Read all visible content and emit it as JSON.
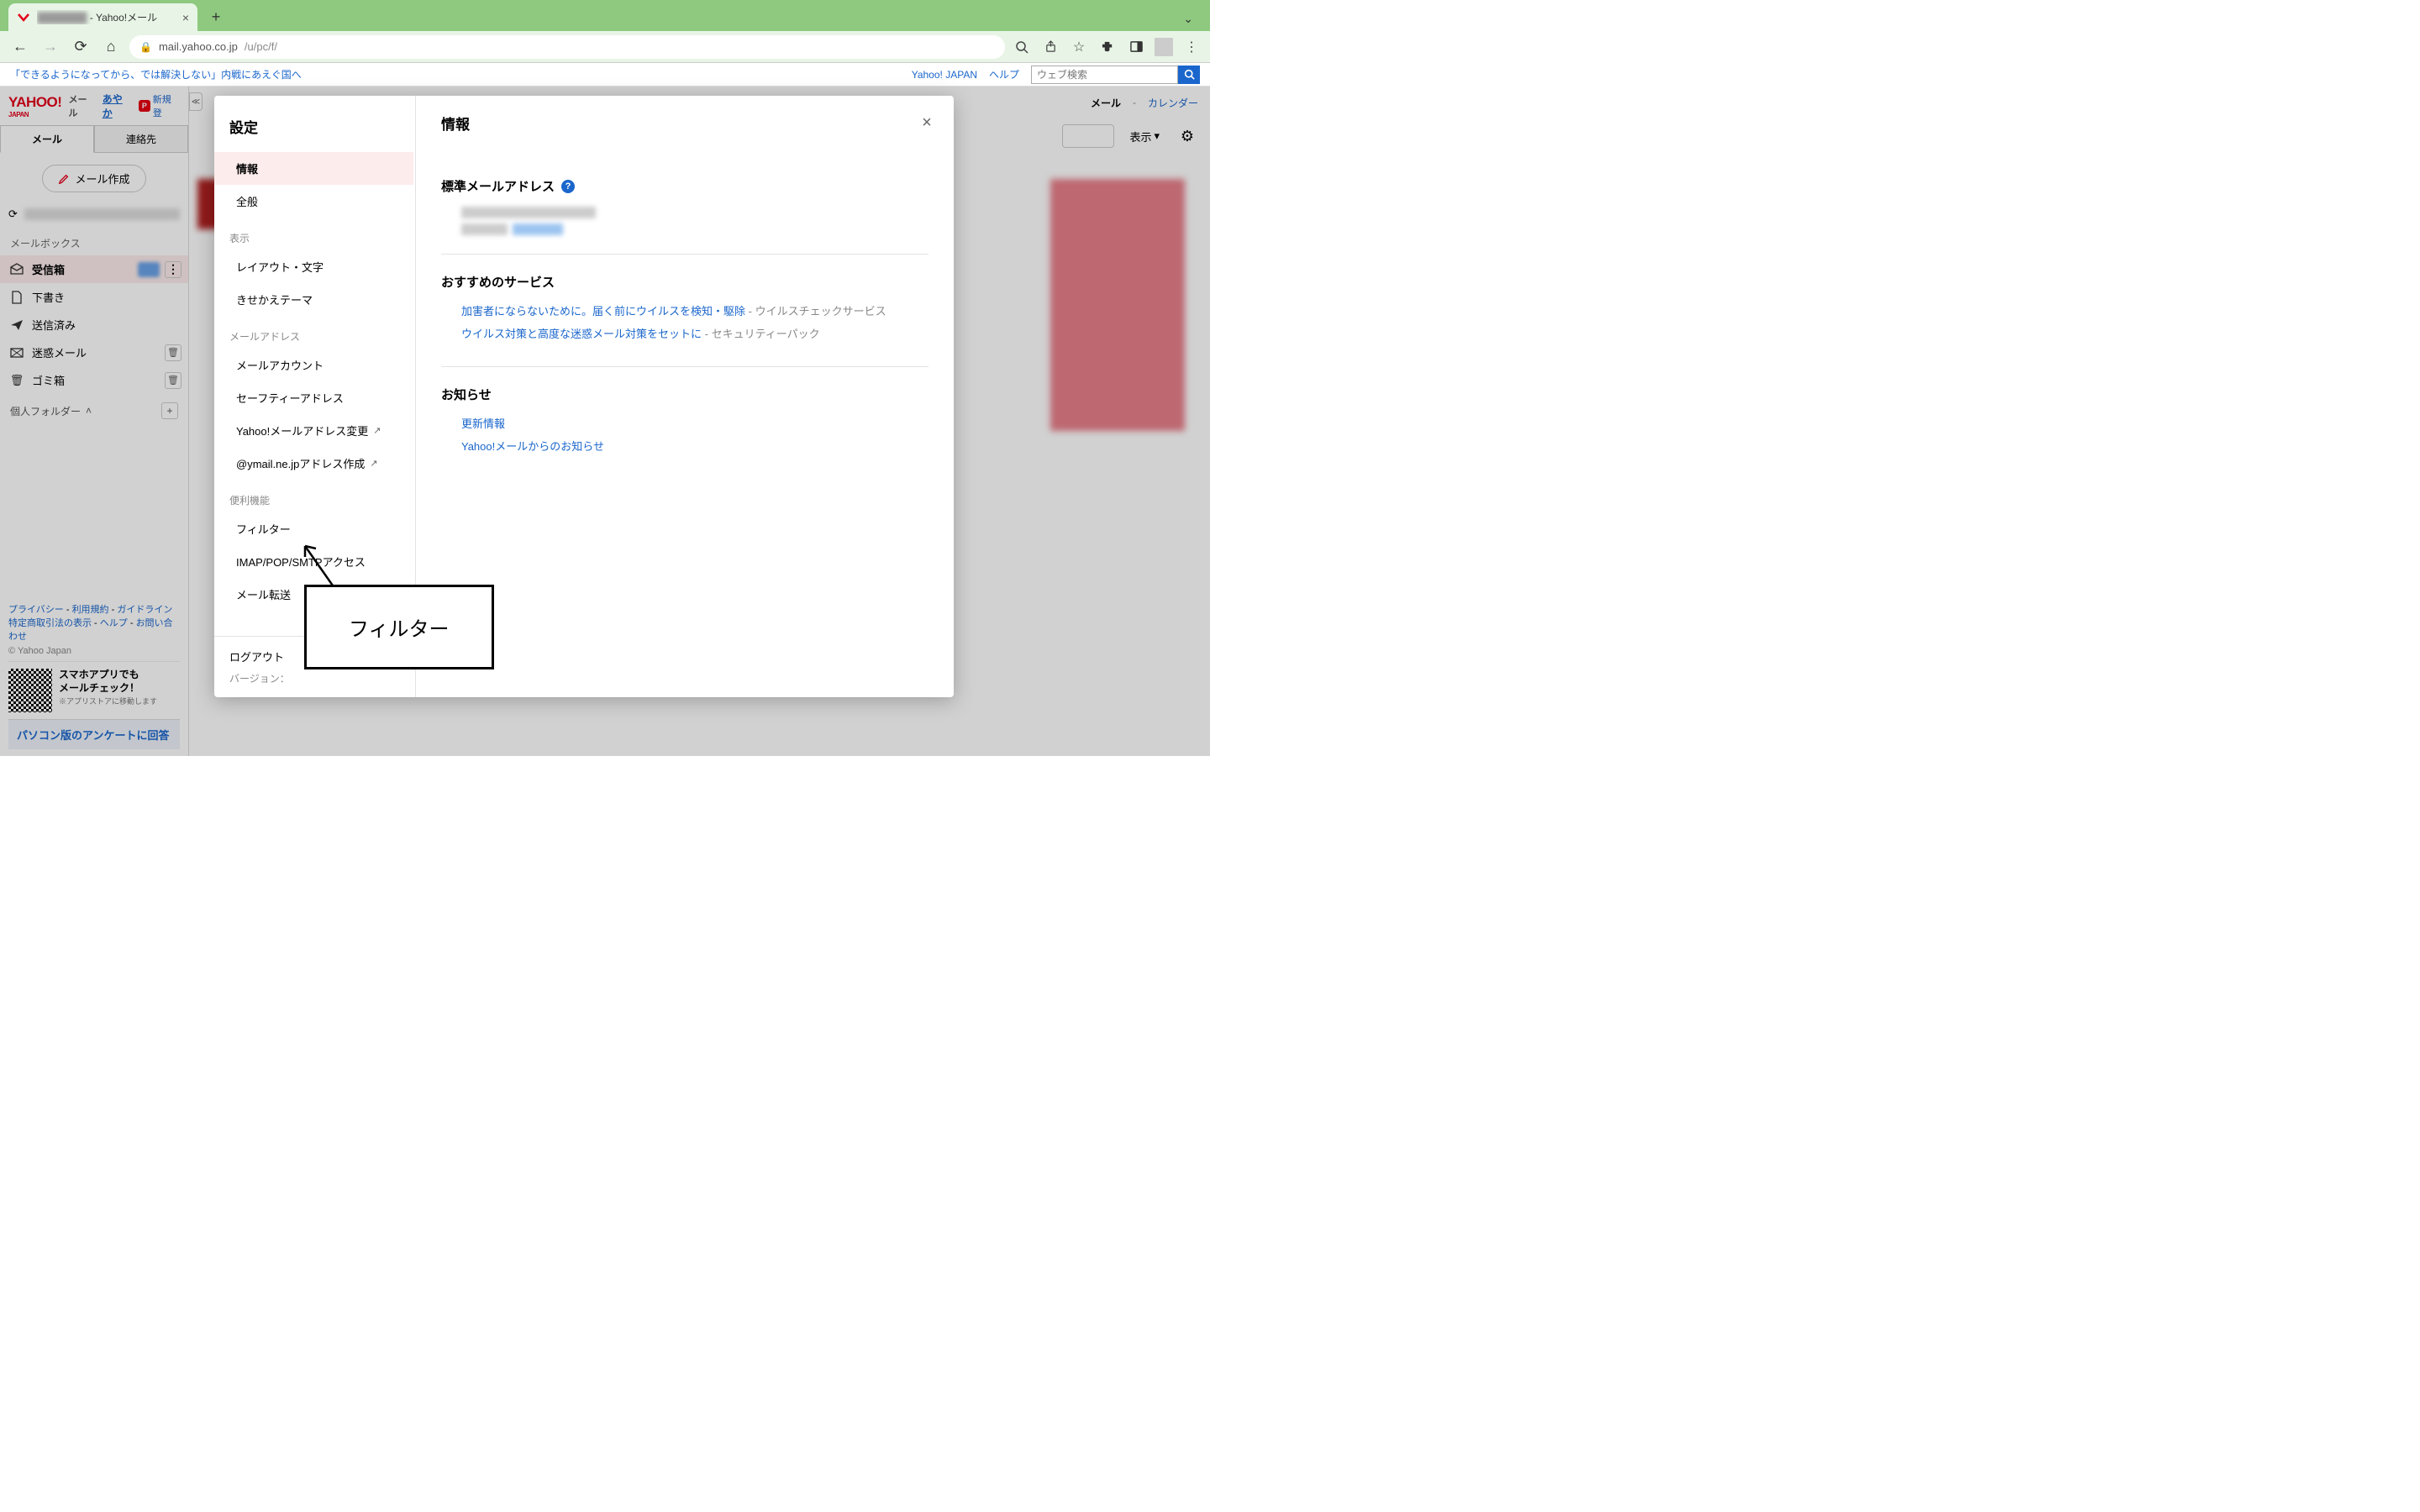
{
  "browser": {
    "tab_title_suffix": "- Yahoo!メール",
    "url_host": "mail.yahoo.co.jp",
    "url_path": "/u/pc/f/"
  },
  "yahoo_bar": {
    "news_link": "「できるようになってから、では解決しない」内戦にあえぐ国へ",
    "japan_link": "Yahoo! JAPAN",
    "help_link": "ヘルプ",
    "search_placeholder": "ウェブ検索"
  },
  "brand": {
    "logo": "YAHOO!",
    "logo_sub": "JAPAN",
    "mail_label": "メール",
    "user": "あやか",
    "new_reg": "新規登"
  },
  "sidebar": {
    "tab_mail": "メール",
    "tab_contacts": "連絡先",
    "compose": "メール作成",
    "mailbox_label": "メールボックス",
    "folders": {
      "inbox": "受信箱",
      "drafts": "下書き",
      "sent": "送信済み",
      "spam": "迷惑メール",
      "trash": "ゴミ箱"
    },
    "personal_folder": "個人フォルダー",
    "footer_links": {
      "privacy": "プライバシー",
      "terms": "利用規約",
      "guidelines": "ガイドライン",
      "commerce": "特定商取引法の表示",
      "help": "ヘルプ",
      "contact": "お問い合わせ"
    },
    "copyright": "© Yahoo Japan",
    "app_promo_line1": "スマホアプリでも",
    "app_promo_line2": "メールチェック！",
    "app_promo_note": "※アプリストアに移動します",
    "survey": "パソコン版のアンケートに回答"
  },
  "right_header": {
    "mail": "メール",
    "calendar": "カレンダー",
    "display": "表示"
  },
  "modal": {
    "title": "設定",
    "right_title": "情報",
    "nav": {
      "info": "情報",
      "general": "全般",
      "section_display": "表示",
      "layout": "レイアウト・文字",
      "theme": "きせかえテーマ",
      "section_mail_address": "メールアドレス",
      "accounts": "メールアカウント",
      "safety": "セーフティーアドレス",
      "change_addr": "Yahoo!メールアドレス変更",
      "create_ymail": "@ymail.ne.jpアドレス作成",
      "section_features": "便利機能",
      "filter": "フィルター",
      "imap": "IMAP/POP/SMTPアクセス",
      "forward": "メール転送",
      "logout": "ログアウト",
      "version_label": "バージョン："
    },
    "sections": {
      "standard_email": "標準メールアドレス",
      "recommended": "おすすめのサービス",
      "service1_link": "加害者にならないために。届く前にウイルスを検知・駆除",
      "service1_desc": " - ウイルスチェックサービス",
      "service2_link": "ウイルス対策と高度な迷惑メール対策をセットに",
      "service2_desc": " - セキュリティーパック",
      "notices": "お知らせ",
      "notice1": "更新情報",
      "notice2": "Yahoo!メールからのお知らせ"
    }
  },
  "callout": {
    "header_hint": "便利機能",
    "text": "フィルター"
  }
}
